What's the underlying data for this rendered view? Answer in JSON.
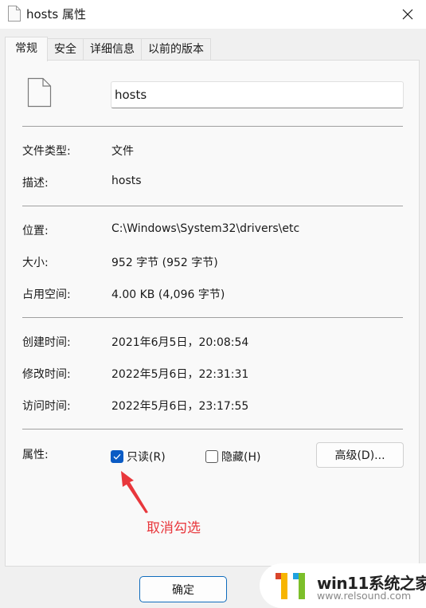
{
  "window": {
    "title": "hosts 属性",
    "close_icon": "close-icon"
  },
  "tabs": [
    {
      "label": "常规",
      "active": true
    },
    {
      "label": "安全",
      "active": false
    },
    {
      "label": "详细信息",
      "active": false
    },
    {
      "label": "以前的版本",
      "active": false
    }
  ],
  "general": {
    "file_icon": "file-icon",
    "name_value": "hosts",
    "rows": {
      "type": {
        "label": "文件类型:",
        "value": "文件"
      },
      "description": {
        "label": "描述:",
        "value": "hosts"
      },
      "location": {
        "label": "位置:",
        "value": "C:\\Windows\\System32\\drivers\\etc"
      },
      "size": {
        "label": "大小:",
        "value": "952 字节 (952 字节)"
      },
      "size_on_disk": {
        "label": "占用空间:",
        "value": "4.00 KB (4,096 字节)"
      },
      "created": {
        "label": "创建时间:",
        "value": "2021年6月5日，20:08:54"
      },
      "modified": {
        "label": "修改时间:",
        "value": "2022年5月6日，22:31:31"
      },
      "accessed": {
        "label": "访问时间:",
        "value": "2022年5月6日，23:17:55"
      }
    },
    "attributes": {
      "label": "属性:",
      "readonly": {
        "label": "只读(R)",
        "checked": true
      },
      "hidden": {
        "label": "隐藏(H)",
        "checked": false
      },
      "advanced_label": "高级(D)..."
    }
  },
  "annotation": {
    "text": "取消勾选",
    "color": "#e8373c"
  },
  "footer": {
    "ok_label": "确定"
  },
  "watermark": {
    "title": "win11系统之家",
    "url": "www.relsound.com"
  },
  "colors": {
    "accent": "#0a5bc4",
    "panel_bg": "#f9f9f9",
    "window_bg": "#f0f0f0"
  }
}
